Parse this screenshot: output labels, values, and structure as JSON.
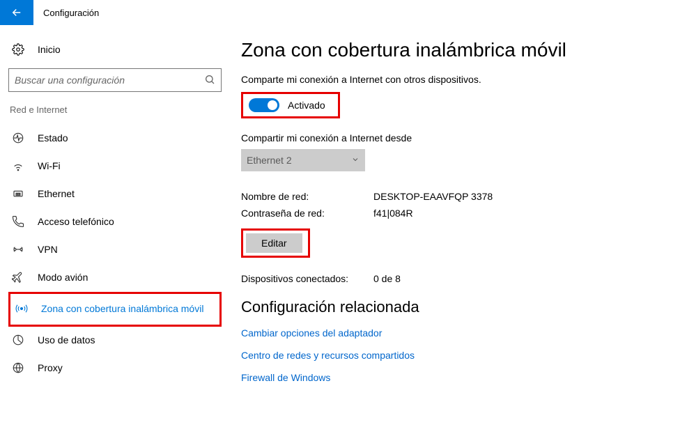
{
  "titlebar": {
    "title": "Configuración"
  },
  "sidebar": {
    "home": "Inicio",
    "search_placeholder": "Buscar una configuración",
    "category": "Red e Internet",
    "items": [
      {
        "label": "Estado"
      },
      {
        "label": "Wi-Fi"
      },
      {
        "label": "Ethernet"
      },
      {
        "label": "Acceso telefónico"
      },
      {
        "label": "VPN"
      },
      {
        "label": "Modo avión"
      },
      {
        "label": "Zona con cobertura inalámbrica móvil"
      },
      {
        "label": "Uso de datos"
      },
      {
        "label": "Proxy"
      }
    ]
  },
  "content": {
    "title": "Zona con cobertura inalámbrica móvil",
    "share_text": "Comparte mi conexión a Internet con otros dispositivos.",
    "toggle_label": "Activado",
    "share_from_label": "Compartir mi conexión a Internet desde",
    "share_from_value": "Ethernet 2",
    "net_name_label": "Nombre de red:",
    "net_name_value": "DESKTOP-EAAVFQP 3378",
    "pwd_label": "Contraseña de red:",
    "pwd_value": "f41|084R",
    "edit_label": "Editar",
    "connected_label": "Dispositivos conectados:",
    "connected_value": "0 de 8",
    "related_title": "Configuración relacionada",
    "links": [
      "Cambiar opciones del adaptador",
      "Centro de redes y recursos compartidos",
      "Firewall de Windows"
    ]
  }
}
